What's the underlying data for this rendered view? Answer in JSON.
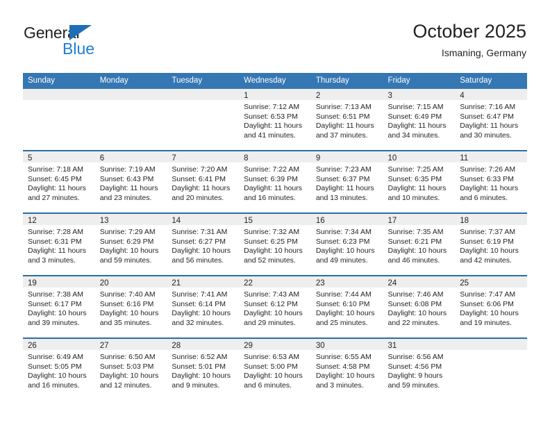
{
  "logo": {
    "word_top": "General",
    "word_bottom": "Blue",
    "triangle_color": "#1e6fb8",
    "bottom_color": "#1e7fd4"
  },
  "header": {
    "title": "October 2025",
    "location": "Ismaning, Germany"
  },
  "colors": {
    "header_blue": "#3577b3",
    "week_divider_blue": "#2b6ca3",
    "daynum_strip_gray": "#eeeeee",
    "text": "#231f20"
  },
  "weekday_headers": [
    "Sunday",
    "Monday",
    "Tuesday",
    "Wednesday",
    "Thursday",
    "Friday",
    "Saturday"
  ],
  "weeks": [
    [
      {
        "day": "",
        "lines": []
      },
      {
        "day": "",
        "lines": []
      },
      {
        "day": "",
        "lines": []
      },
      {
        "day": "1",
        "lines": [
          "Sunrise: 7:12 AM",
          "Sunset: 6:53 PM",
          "Daylight: 11 hours",
          "and 41 minutes."
        ]
      },
      {
        "day": "2",
        "lines": [
          "Sunrise: 7:13 AM",
          "Sunset: 6:51 PM",
          "Daylight: 11 hours",
          "and 37 minutes."
        ]
      },
      {
        "day": "3",
        "lines": [
          "Sunrise: 7:15 AM",
          "Sunset: 6:49 PM",
          "Daylight: 11 hours",
          "and 34 minutes."
        ]
      },
      {
        "day": "4",
        "lines": [
          "Sunrise: 7:16 AM",
          "Sunset: 6:47 PM",
          "Daylight: 11 hours",
          "and 30 minutes."
        ]
      }
    ],
    [
      {
        "day": "5",
        "lines": [
          "Sunrise: 7:18 AM",
          "Sunset: 6:45 PM",
          "Daylight: 11 hours",
          "and 27 minutes."
        ]
      },
      {
        "day": "6",
        "lines": [
          "Sunrise: 7:19 AM",
          "Sunset: 6:43 PM",
          "Daylight: 11 hours",
          "and 23 minutes."
        ]
      },
      {
        "day": "7",
        "lines": [
          "Sunrise: 7:20 AM",
          "Sunset: 6:41 PM",
          "Daylight: 11 hours",
          "and 20 minutes."
        ]
      },
      {
        "day": "8",
        "lines": [
          "Sunrise: 7:22 AM",
          "Sunset: 6:39 PM",
          "Daylight: 11 hours",
          "and 16 minutes."
        ]
      },
      {
        "day": "9",
        "lines": [
          "Sunrise: 7:23 AM",
          "Sunset: 6:37 PM",
          "Daylight: 11 hours",
          "and 13 minutes."
        ]
      },
      {
        "day": "10",
        "lines": [
          "Sunrise: 7:25 AM",
          "Sunset: 6:35 PM",
          "Daylight: 11 hours",
          "and 10 minutes."
        ]
      },
      {
        "day": "11",
        "lines": [
          "Sunrise: 7:26 AM",
          "Sunset: 6:33 PM",
          "Daylight: 11 hours",
          "and 6 minutes."
        ]
      }
    ],
    [
      {
        "day": "12",
        "lines": [
          "Sunrise: 7:28 AM",
          "Sunset: 6:31 PM",
          "Daylight: 11 hours",
          "and 3 minutes."
        ]
      },
      {
        "day": "13",
        "lines": [
          "Sunrise: 7:29 AM",
          "Sunset: 6:29 PM",
          "Daylight: 10 hours",
          "and 59 minutes."
        ]
      },
      {
        "day": "14",
        "lines": [
          "Sunrise: 7:31 AM",
          "Sunset: 6:27 PM",
          "Daylight: 10 hours",
          "and 56 minutes."
        ]
      },
      {
        "day": "15",
        "lines": [
          "Sunrise: 7:32 AM",
          "Sunset: 6:25 PM",
          "Daylight: 10 hours",
          "and 52 minutes."
        ]
      },
      {
        "day": "16",
        "lines": [
          "Sunrise: 7:34 AM",
          "Sunset: 6:23 PM",
          "Daylight: 10 hours",
          "and 49 minutes."
        ]
      },
      {
        "day": "17",
        "lines": [
          "Sunrise: 7:35 AM",
          "Sunset: 6:21 PM",
          "Daylight: 10 hours",
          "and 46 minutes."
        ]
      },
      {
        "day": "18",
        "lines": [
          "Sunrise: 7:37 AM",
          "Sunset: 6:19 PM",
          "Daylight: 10 hours",
          "and 42 minutes."
        ]
      }
    ],
    [
      {
        "day": "19",
        "lines": [
          "Sunrise: 7:38 AM",
          "Sunset: 6:17 PM",
          "Daylight: 10 hours",
          "and 39 minutes."
        ]
      },
      {
        "day": "20",
        "lines": [
          "Sunrise: 7:40 AM",
          "Sunset: 6:16 PM",
          "Daylight: 10 hours",
          "and 35 minutes."
        ]
      },
      {
        "day": "21",
        "lines": [
          "Sunrise: 7:41 AM",
          "Sunset: 6:14 PM",
          "Daylight: 10 hours",
          "and 32 minutes."
        ]
      },
      {
        "day": "22",
        "lines": [
          "Sunrise: 7:43 AM",
          "Sunset: 6:12 PM",
          "Daylight: 10 hours",
          "and 29 minutes."
        ]
      },
      {
        "day": "23",
        "lines": [
          "Sunrise: 7:44 AM",
          "Sunset: 6:10 PM",
          "Daylight: 10 hours",
          "and 25 minutes."
        ]
      },
      {
        "day": "24",
        "lines": [
          "Sunrise: 7:46 AM",
          "Sunset: 6:08 PM",
          "Daylight: 10 hours",
          "and 22 minutes."
        ]
      },
      {
        "day": "25",
        "lines": [
          "Sunrise: 7:47 AM",
          "Sunset: 6:06 PM",
          "Daylight: 10 hours",
          "and 19 minutes."
        ]
      }
    ],
    [
      {
        "day": "26",
        "lines": [
          "Sunrise: 6:49 AM",
          "Sunset: 5:05 PM",
          "Daylight: 10 hours",
          "and 16 minutes."
        ]
      },
      {
        "day": "27",
        "lines": [
          "Sunrise: 6:50 AM",
          "Sunset: 5:03 PM",
          "Daylight: 10 hours",
          "and 12 minutes."
        ]
      },
      {
        "day": "28",
        "lines": [
          "Sunrise: 6:52 AM",
          "Sunset: 5:01 PM",
          "Daylight: 10 hours",
          "and 9 minutes."
        ]
      },
      {
        "day": "29",
        "lines": [
          "Sunrise: 6:53 AM",
          "Sunset: 5:00 PM",
          "Daylight: 10 hours",
          "and 6 minutes."
        ]
      },
      {
        "day": "30",
        "lines": [
          "Sunrise: 6:55 AM",
          "Sunset: 4:58 PM",
          "Daylight: 10 hours",
          "and 3 minutes."
        ]
      },
      {
        "day": "31",
        "lines": [
          "Sunrise: 6:56 AM",
          "Sunset: 4:56 PM",
          "Daylight: 9 hours",
          "and 59 minutes."
        ]
      },
      {
        "day": "",
        "lines": []
      }
    ]
  ]
}
